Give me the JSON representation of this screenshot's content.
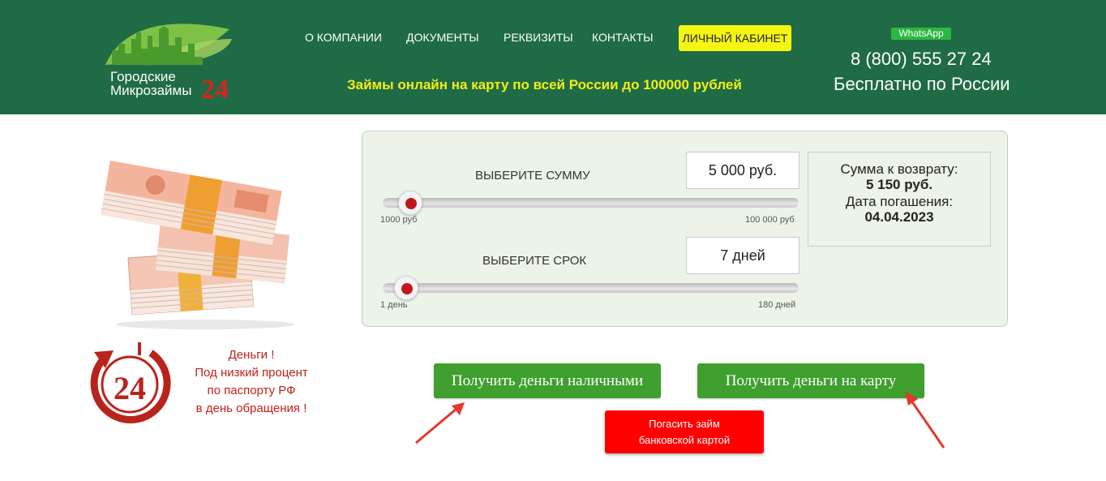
{
  "header": {
    "logo": {
      "line1": "Городские",
      "line2": "Микрозаймы",
      "number": "24"
    },
    "nav": [
      "О КОМПАНИИ",
      "ДОКУМЕНТЫ",
      "РЕКВИЗИТЫ",
      "КОНТАКТЫ"
    ],
    "cabinet_label": "ЛИЧНЫЙ КАБИНЕТ",
    "tagline": "Займы онлайн на карту по всей России до 100000 рублей",
    "whatsapp": "WhatsApp",
    "phone": "8 (800) 555 27 24",
    "phone_note": "Бесплатно по России"
  },
  "calculator": {
    "amount": {
      "label": "ВЫБЕРИТЕ СУММУ",
      "value": "5 000 руб.",
      "min_label": "1000 руб",
      "max_label": "100 000 руб",
      "level": 0.04
    },
    "term": {
      "label": "ВЫБЕРИТЕ СРОК",
      "value": "7 дней",
      "min_label": "1 день",
      "max_label": "180 дней",
      "level": 0.03
    },
    "summary": {
      "return_label": "Сумма к возврату:",
      "return_value": "5 150 руб.",
      "date_label": "Дата погашения:",
      "date_value": "04.04.2023"
    }
  },
  "promo": {
    "badge_number": "24",
    "line1": "Деньги !",
    "line2": "Под низкий процент",
    "line3": "по паспорту РФ",
    "line4": "в день обращения !"
  },
  "buttons": {
    "cash": "Получить деньги наличными",
    "card": "Получить деньги на карту",
    "repay_line1": "Погасить займ",
    "repay_line2": "банковской картой"
  },
  "colors": {
    "header_bg": "#1f6b45",
    "accent_yellow": "#f5f514",
    "button_green": "#3f9f2f",
    "button_red": "#ff0000",
    "slider_thumb": "#c2161d"
  }
}
